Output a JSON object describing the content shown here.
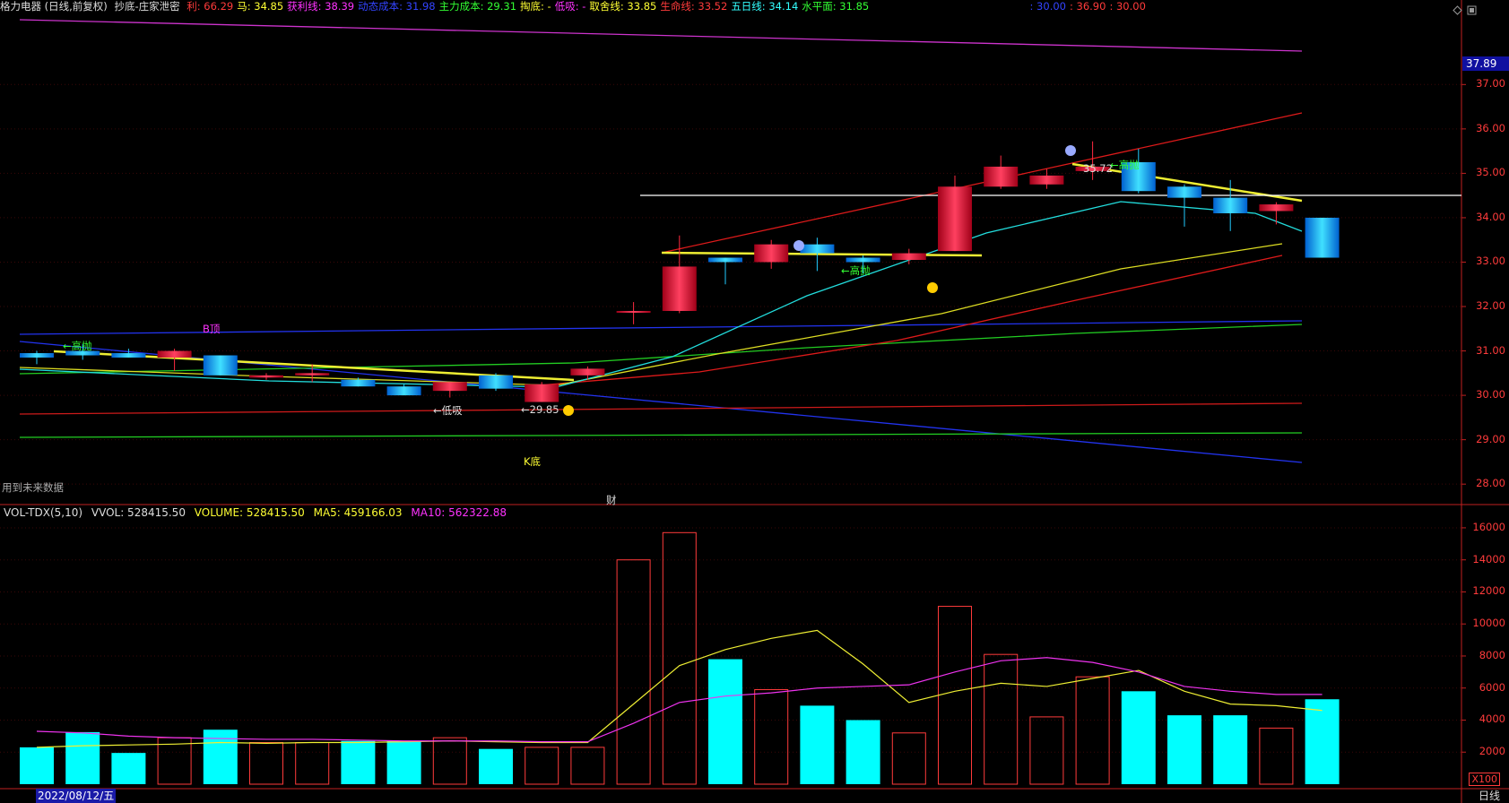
{
  "header": {
    "title": "格力电器 (日线,前复权)",
    "indicator": "抄底-庄家泄密",
    "items": [
      {
        "label": "利:",
        "value": "66.29",
        "color": "#ff3b3b"
      },
      {
        "label": "马:",
        "value": "34.85",
        "color": "#ffff33"
      },
      {
        "label": "获利线:",
        "value": "38.39",
        "color": "#ff33ff"
      },
      {
        "label": "动态成本:",
        "value": "31.98",
        "color": "#3344ff"
      },
      {
        "label": "主力成本:",
        "value": "29.31",
        "color": "#33ff33"
      },
      {
        "label": "掏底:",
        "value": "-",
        "color": "#ffff33"
      },
      {
        "label": "低吸:",
        "value": "-",
        "color": "#ff33ff"
      },
      {
        "label": "取舍线:",
        "value": "33.85",
        "color": "#ffff33"
      },
      {
        "label": "生命线:",
        "value": "33.52",
        "color": "#ff3b3b"
      },
      {
        "label": "五日线:",
        "value": "34.14",
        "color": "#33ffff"
      },
      {
        "label": "水平面:",
        "value": "31.85",
        "color": "#33ff33"
      }
    ],
    "extra": [
      {
        "text": ": 30.00",
        "color": "#3344ff"
      },
      {
        "text": ": 36.90",
        "color": "#ff3b3b"
      },
      {
        "text": ": 30.00",
        "color": "#ff3b3b"
      }
    ]
  },
  "price_axis": {
    "current": "37.89",
    "ticks": [
      "37.00",
      "36.00",
      "35.00",
      "34.00",
      "33.00",
      "32.00",
      "31.00",
      "30.00",
      "29.00",
      "28.00"
    ]
  },
  "annotations": {
    "future_data": "用到未来数据",
    "cai": "财",
    "gaopao": "←高抛",
    "dixi": "←低吸",
    "low_price": "←29.85",
    "high_price": "35.72",
    "b_top": "B顶",
    "k_bottom": "K底"
  },
  "volume": {
    "name": "VOL-TDX(5,10)",
    "vvol": "VVOL: 528415.50",
    "volume": "VOLUME: 528415.50",
    "ma5": "MA5: 459166.03",
    "ma10": "MA10: 562322.88",
    "ticks": [
      "16000",
      "14000",
      "12000",
      "10000",
      "8000",
      "6000",
      "4000",
      "2000"
    ],
    "unit": "X100"
  },
  "footer": {
    "date": "2022/08/12/五",
    "period": "日线"
  },
  "colors": {
    "up": "#ff2a40",
    "down": "#22ccff",
    "vol_down": "#00ffff",
    "axis": "#ff3b3b"
  },
  "chart_data": {
    "type": "candlestick",
    "price_range": [
      27.6,
      38.5
    ],
    "volume_range": [
      0,
      16500
    ],
    "candles": [
      {
        "o": 30.85,
        "h": 31.0,
        "l": 30.7,
        "c": 30.95,
        "dir": "down",
        "vol": 2300
      },
      {
        "o": 31.0,
        "h": 31.15,
        "l": 30.8,
        "c": 30.9,
        "dir": "down",
        "vol": 3250
      },
      {
        "o": 30.95,
        "h": 31.05,
        "l": 30.85,
        "c": 30.85,
        "dir": "down",
        "vol": 1950
      },
      {
        "o": 30.85,
        "h": 31.05,
        "l": 30.55,
        "c": 31.0,
        "dir": "up",
        "vol": 2900
      },
      {
        "o": 30.9,
        "h": 30.9,
        "l": 30.45,
        "c": 30.45,
        "dir": "down",
        "vol": 3400
      },
      {
        "o": 30.4,
        "h": 30.5,
        "l": 30.35,
        "c": 30.45,
        "dir": "up",
        "vol": 2600
      },
      {
        "o": 30.45,
        "h": 30.7,
        "l": 30.3,
        "c": 30.5,
        "dir": "up",
        "vol": 2600
      },
      {
        "o": 30.35,
        "h": 30.4,
        "l": 30.2,
        "c": 30.2,
        "dir": "down",
        "vol": 2700
      },
      {
        "o": 30.2,
        "h": 30.25,
        "l": 30.0,
        "c": 30.0,
        "dir": "down",
        "vol": 2700
      },
      {
        "o": 30.1,
        "h": 30.3,
        "l": 29.95,
        "c": 30.3,
        "dir": "up",
        "vol": 2900
      },
      {
        "o": 30.45,
        "h": 30.5,
        "l": 30.1,
        "c": 30.15,
        "dir": "down",
        "vol": 2200
      },
      {
        "o": 29.85,
        "h": 30.3,
        "l": 29.85,
        "c": 30.25,
        "dir": "up",
        "vol": 2300
      },
      {
        "o": 30.45,
        "h": 30.65,
        "l": 30.35,
        "c": 30.6,
        "dir": "up",
        "vol": 2300
      },
      {
        "o": 31.9,
        "h": 32.1,
        "l": 31.6,
        "c": 31.9,
        "dir": "up",
        "vol": 14000
      },
      {
        "o": 31.9,
        "h": 33.6,
        "l": 31.85,
        "c": 32.9,
        "dir": "up",
        "vol": 15700
      },
      {
        "o": 33.1,
        "h": 33.1,
        "l": 32.5,
        "c": 33.0,
        "dir": "down",
        "vol": 7800
      },
      {
        "o": 33.0,
        "h": 33.5,
        "l": 32.85,
        "c": 33.4,
        "dir": "up",
        "vol": 5900
      },
      {
        "o": 33.4,
        "h": 33.55,
        "l": 32.8,
        "c": 33.2,
        "dir": "down",
        "vol": 4900
      },
      {
        "o": 33.1,
        "h": 33.15,
        "l": 32.75,
        "c": 33.0,
        "dir": "down",
        "vol": 4000
      },
      {
        "o": 33.05,
        "h": 33.3,
        "l": 32.95,
        "c": 33.2,
        "dir": "up",
        "vol": 3200
      },
      {
        "o": 33.25,
        "h": 34.95,
        "l": 33.25,
        "c": 34.7,
        "dir": "up",
        "vol": 11100
      },
      {
        "o": 34.7,
        "h": 35.4,
        "l": 34.65,
        "c": 35.15,
        "dir": "up",
        "vol": 8100
      },
      {
        "o": 34.75,
        "h": 35.1,
        "l": 34.65,
        "c": 34.95,
        "dir": "up",
        "vol": 4200
      },
      {
        "o": 35.05,
        "h": 35.72,
        "l": 34.85,
        "c": 35.15,
        "dir": "up",
        "vol": 6700
      },
      {
        "o": 35.25,
        "h": 35.55,
        "l": 34.55,
        "c": 34.6,
        "dir": "down",
        "vol": 5800
      },
      {
        "o": 34.7,
        "h": 34.75,
        "l": 33.8,
        "c": 34.45,
        "dir": "down",
        "vol": 4300
      },
      {
        "o": 34.45,
        "h": 34.85,
        "l": 33.7,
        "c": 34.1,
        "dir": "down",
        "vol": 4300
      },
      {
        "o": 34.15,
        "h": 34.35,
        "l": 33.85,
        "c": 34.3,
        "dir": "up",
        "vol": 3500
      },
      {
        "o": 34.0,
        "h": 34.0,
        "l": 33.1,
        "c": 33.1,
        "dir": "down",
        "vol": 5300
      }
    ],
    "ma5": [
      2300,
      2400,
      2450,
      2500,
      2600,
      2550,
      2600,
      2600,
      2650,
      2700,
      2650,
      2600,
      2600,
      5000,
      7400,
      8400,
      9100,
      9600,
      7500,
      5100,
      5800,
      6300,
      6100,
      6600,
      7100,
      5800,
      5000,
      4900,
      4600
    ],
    "ma10": [
      3300,
      3200,
      3000,
      2900,
      2850,
      2800,
      2800,
      2750,
      2700,
      2700,
      2700,
      2650,
      2650,
      3800,
      5100,
      5500,
      5700,
      6000,
      6100,
      6200,
      7000,
      7700,
      7900,
      7600,
      7000,
      6100,
      5800,
      5600,
      5600
    ]
  }
}
